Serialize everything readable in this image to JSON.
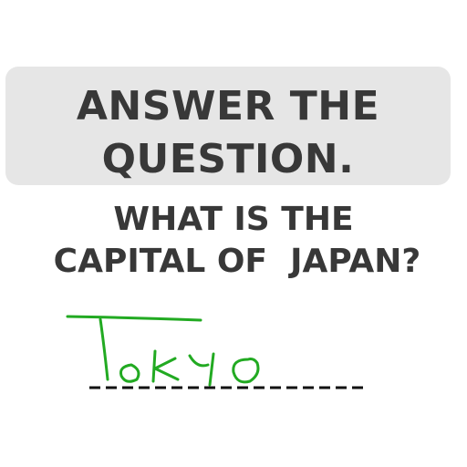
{
  "instruction": {
    "line1": "ANSWER THE",
    "line2": "QUESTION."
  },
  "question": {
    "line1": "WHAT IS THE",
    "line2": "CAPITAL OF  JAPAN?"
  },
  "answer": {
    "handwritten_text": "Tokyo",
    "ink_color": "#22aa22",
    "blank_color": "#111111"
  },
  "colors": {
    "instruction_background": "#e6e6e6",
    "text": "#383838",
    "background": "#ffffff"
  }
}
